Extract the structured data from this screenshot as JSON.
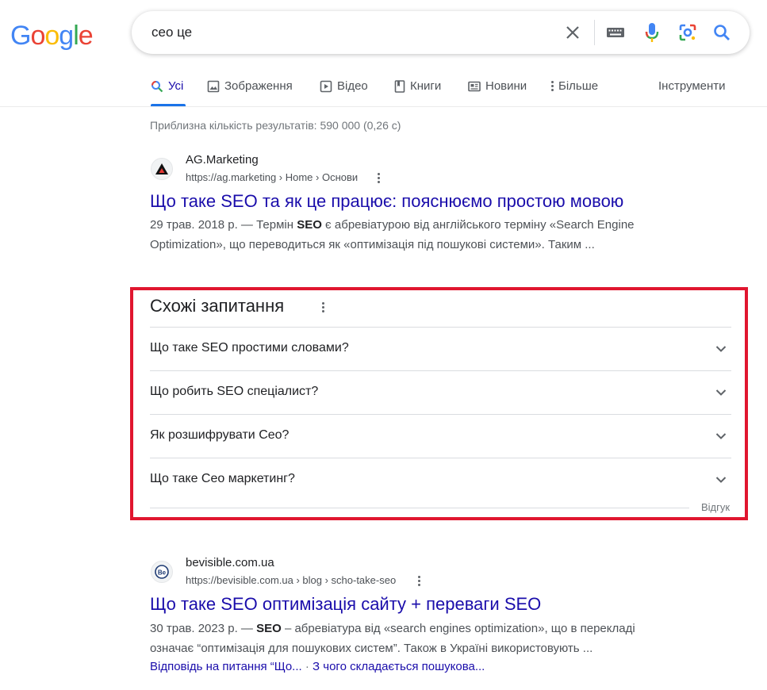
{
  "logo": {
    "letters": [
      "G",
      "o",
      "o",
      "g",
      "l",
      "e"
    ],
    "colors": [
      "#4285F4",
      "#EA4335",
      "#FBBC05",
      "#4285F4",
      "#34A853",
      "#EA4335"
    ]
  },
  "search": {
    "query": "сео це"
  },
  "tabs": [
    {
      "label": "Усі",
      "icon": "search-icon"
    },
    {
      "label": "Зображення",
      "icon": "image-icon"
    },
    {
      "label": "Відео",
      "icon": "video-icon"
    },
    {
      "label": "Книги",
      "icon": "book-icon"
    },
    {
      "label": "Новини",
      "icon": "news-icon"
    },
    {
      "label": "Більше",
      "icon": "more-vert-icon"
    },
    {
      "label": "Інструменти",
      "icon": ""
    }
  ],
  "stats": "Приблизна кількість результатів: 590 000 (0,26 с)",
  "results": [
    {
      "site_name": "AG.Marketing",
      "url": "https://ag.marketing › Home › Основи",
      "title": "Що таке SEO та як це працює: пояснюємо простою мовою",
      "date": "29 трав. 2018 р. — Термін ",
      "bold": "SEO",
      "line1_rest": " є абревіатурою від англійського терміну «Search Engine",
      "line2": "Optimization», що переводиться як «оптимізація під пошукові системи». Таким ..."
    },
    {
      "site_name": "bevisible.com.ua",
      "url": "https://bevisible.com.ua › blog › scho-take-seo",
      "title": "Що таке SEO оптимізація сайту + переваги SEO",
      "date": "30 трав. 2023 р. — ",
      "bold": "SEO",
      "line1_rest": " – абревіатура від «search engines optimization», що в перекладі",
      "line2": "означає “оптимізація для пошукових систем”. Також в Україні використовують ...",
      "sitelinks": [
        "Відповідь на питання “Що...",
        "З чого складається пошукова..."
      ],
      "sitelink_sep": " · "
    }
  ],
  "paa": {
    "title": "Схожі запитання",
    "questions": [
      "Що таке SEO простими словами?",
      "Що робить SEO спеціалист?",
      "Як розшифрувати Сео?",
      "Що таке Сео маркетинг?"
    ],
    "feedback": "Відгук"
  },
  "colors": {
    "link": "#1a0dab",
    "accent": "#1a73e8",
    "highlight_frame": "#e0162f"
  }
}
